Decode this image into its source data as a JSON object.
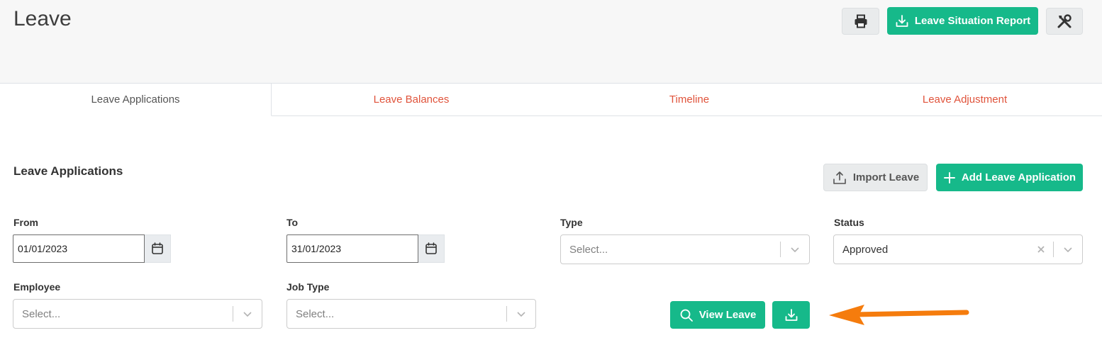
{
  "header": {
    "title": "Leave",
    "print_icon": "printer-icon",
    "report_label": "Leave Situation Report",
    "settings_icon": "tools-icon"
  },
  "tabs": [
    {
      "label": "Leave Applications",
      "active": true
    },
    {
      "label": "Leave Balances",
      "active": false
    },
    {
      "label": "Timeline",
      "active": false
    },
    {
      "label": "Leave Adjustment",
      "active": false
    }
  ],
  "section": {
    "title": "Leave Applications",
    "import_label": "Import Leave",
    "add_label": "Add Leave Application"
  },
  "filters": {
    "from": {
      "label": "From",
      "value": "01/01/2023"
    },
    "to": {
      "label": "To",
      "value": "31/01/2023"
    },
    "type": {
      "label": "Type",
      "placeholder": "Select..."
    },
    "status": {
      "label": "Status",
      "value": "Approved"
    },
    "employee": {
      "label": "Employee",
      "placeholder": "Select..."
    },
    "job_type": {
      "label": "Job Type",
      "placeholder": "Select..."
    }
  },
  "actions": {
    "view_label": "View Leave",
    "download_icon": "download-icon"
  },
  "colors": {
    "accent_green": "#16b98a",
    "tab_link": "#e0533b",
    "annotation_arrow": "#f57c0d"
  }
}
